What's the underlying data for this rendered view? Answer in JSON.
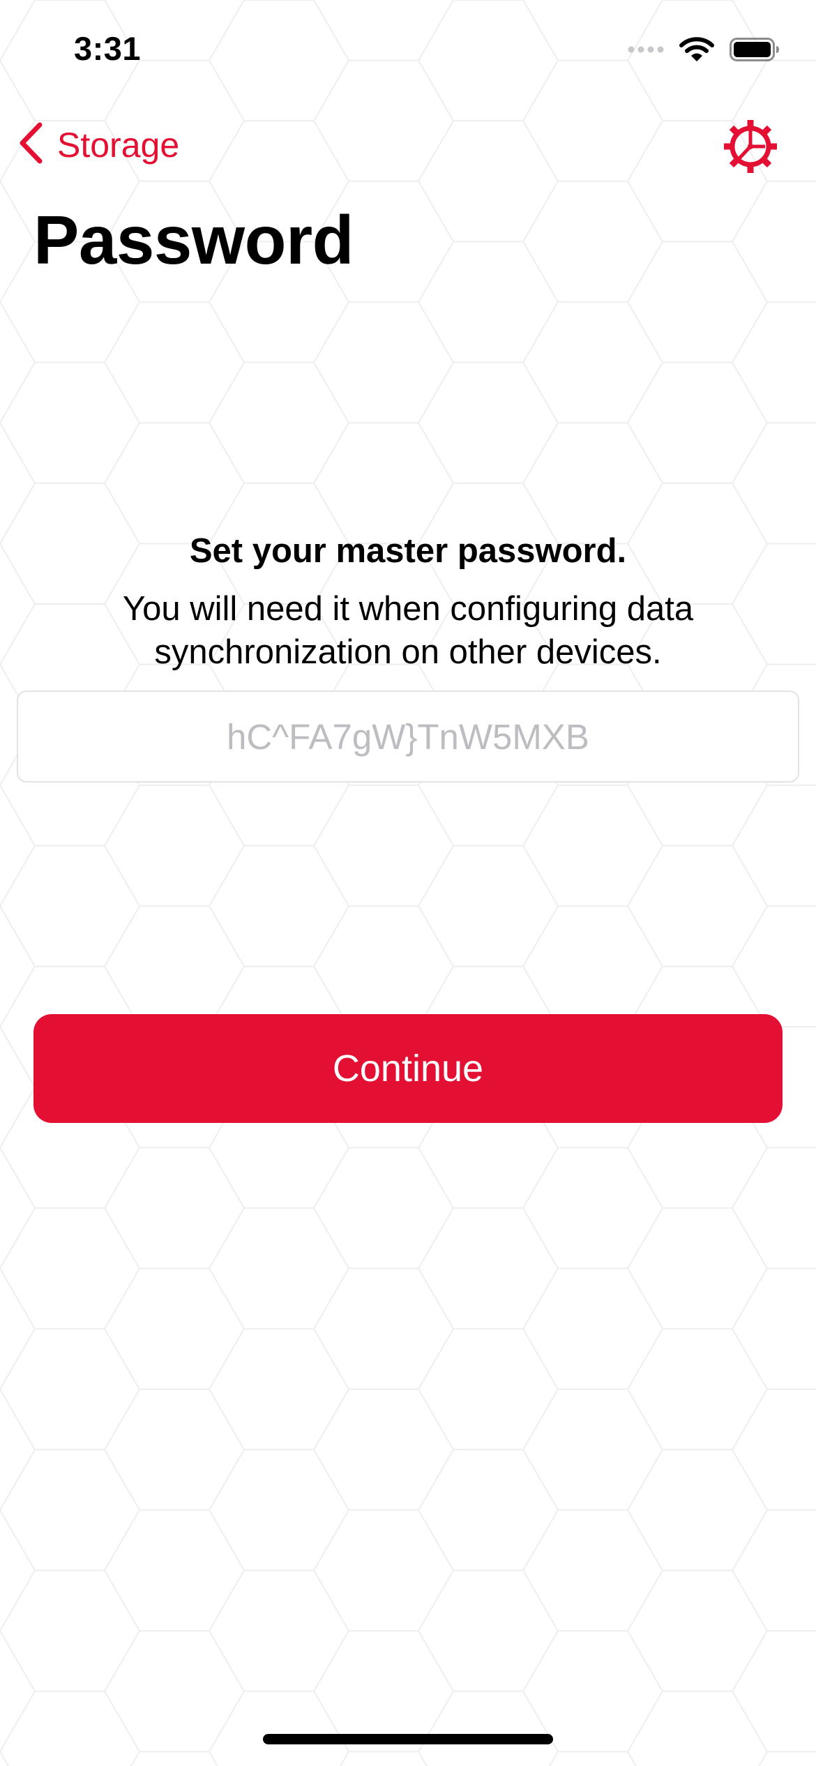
{
  "colors": {
    "accent": "#e31034",
    "background": "#ffffff",
    "hex_pattern": "#eeeeee",
    "placeholder": "#bdbdc1",
    "field_border": "#e3e3e6"
  },
  "status_bar": {
    "time": "3:31",
    "icons": [
      "cellular-signal-icon",
      "wifi-icon",
      "battery-icon"
    ]
  },
  "nav": {
    "back_label": "Storage",
    "back_icon": "chevron-left-icon",
    "settings_icon": "gear-icon"
  },
  "page": {
    "title": "Password"
  },
  "prompt": {
    "heading": "Set your master password.",
    "body": "You will need it when configuring data synchronization on other devices."
  },
  "password_field": {
    "value": "",
    "placeholder": "hC^FA7gW}TnW5MXB"
  },
  "continue_button": {
    "label": "Continue"
  }
}
